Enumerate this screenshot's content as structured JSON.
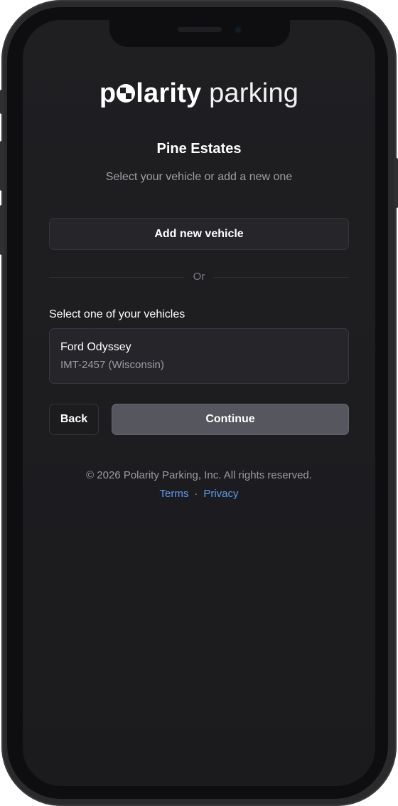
{
  "brand": {
    "bold_start": "p",
    "bold_end": "larity",
    "light": "parking"
  },
  "page": {
    "title": "Pine Estates",
    "subtitle": "Select your vehicle or add a new one"
  },
  "actions": {
    "add_vehicle_label": "Add new vehicle",
    "divider_label": "Or",
    "back_label": "Back",
    "continue_label": "Continue"
  },
  "vehicles": {
    "section_label": "Select one of your vehicles",
    "items": [
      {
        "name": "Ford Odyssey",
        "plate": "IMT-2457 (Wisconsin)"
      }
    ]
  },
  "footer": {
    "copyright": "© 2026 Polarity Parking, Inc. All rights reserved.",
    "terms_label": "Terms",
    "separator": "·",
    "privacy_label": "Privacy"
  },
  "colors": {
    "background": "#1f1f22",
    "primary_button": "#56565e",
    "link": "#5b9cf0",
    "muted_text": "#9a9aa2"
  },
  "icons": {
    "logo_o": "checkered-circle-icon"
  }
}
